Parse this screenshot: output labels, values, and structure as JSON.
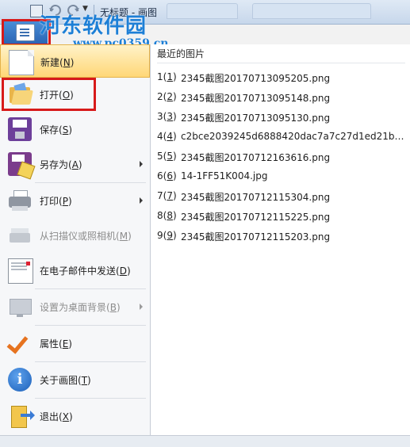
{
  "window": {
    "title": "无标题 - 画图"
  },
  "watermark": {
    "brand": "河东软件园",
    "url": "www.pc0359.cn"
  },
  "menu": {
    "items": [
      {
        "label": "新建",
        "key": "N"
      },
      {
        "label": "打开",
        "key": "O"
      },
      {
        "label": "保存",
        "key": "S"
      },
      {
        "label": "另存为",
        "key": "A"
      },
      {
        "label": "打印",
        "key": "P"
      },
      {
        "label": "从扫描仪或照相机",
        "key": "M"
      },
      {
        "label": "在电子邮件中发送",
        "key": "D"
      },
      {
        "label": "设置为桌面背景",
        "key": "B"
      },
      {
        "label": "属性",
        "key": "E"
      },
      {
        "label": "关于画图",
        "key": "T"
      },
      {
        "label": "退出",
        "key": "X"
      }
    ]
  },
  "recent": {
    "heading": "最近的图片",
    "items": [
      {
        "num": "1",
        "key": "1",
        "name": "2345截图20170713095205.png"
      },
      {
        "num": "2",
        "key": "2",
        "name": "2345截图20170713095148.png"
      },
      {
        "num": "3",
        "key": "3",
        "name": "2345截图20170713095130.png"
      },
      {
        "num": "4",
        "key": "4",
        "name": "c2bce2039245d6888420dac7a7c27d1ed21b247..."
      },
      {
        "num": "5",
        "key": "5",
        "name": "2345截图20170712163616.png"
      },
      {
        "num": "6",
        "key": "6",
        "name": "14-1FF51K004.jpg"
      },
      {
        "num": "7",
        "key": "7",
        "name": "2345截图20170712115304.png"
      },
      {
        "num": "8",
        "key": "8",
        "name": "2345截图20170712115225.png"
      },
      {
        "num": "9",
        "key": "9",
        "name": "2345截图20170712115203.png"
      }
    ]
  },
  "colors": {
    "highlight": "#d71a1a",
    "hover_bg": "#ffd777",
    "accent": "#2a64b3"
  }
}
